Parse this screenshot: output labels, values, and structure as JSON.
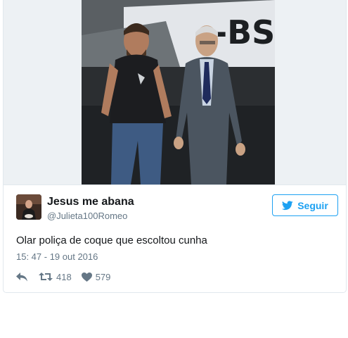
{
  "tweet": {
    "display_name": "Jesus me abana",
    "handle": "@Julieta100Romeo",
    "text": "Olar poliça de coque que escoltou cunha",
    "timestamp": "15: 47 - 19 out 2016",
    "follow_label": "Seguir",
    "retweet_count": "418",
    "like_count": "579",
    "photo_plate_text": "-BS"
  },
  "icons": {
    "follow": "twitter-bird-icon",
    "reply": "reply-icon",
    "retweet": "retweet-icon",
    "like": "heart-icon"
  },
  "colors": {
    "accent": "#1da1f2",
    "muted_text": "#657786",
    "border": "#e1e8ed"
  }
}
